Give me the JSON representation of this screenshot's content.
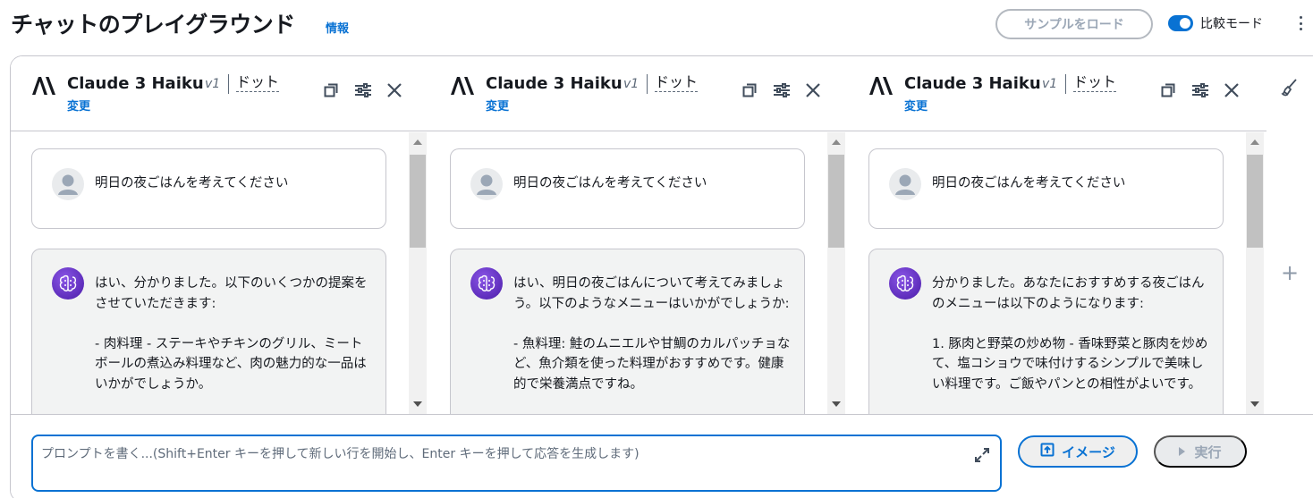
{
  "header": {
    "title": "チャットのプレイグラウンド",
    "info_label": "情報",
    "load_sample_label": "サンプルをロード",
    "compare_mode_label": "比較モード",
    "compare_mode_on": true
  },
  "panels": [
    {
      "model_name": "Claude 3 Haiku",
      "version": "v1",
      "variant": "ドット",
      "change_label": "変更",
      "user_message": "明日の夜ごはんを考えてください",
      "assistant_message": "はい、分かりました。以下のいくつかの提案をさせていただきます:\n\n- 肉料理 - ステーキやチキンのグリル、ミートボールの煮込み料理など、肉の魅力的な一品はいかがでしょうか。"
    },
    {
      "model_name": "Claude 3 Haiku",
      "version": "v1",
      "variant": "ドット",
      "change_label": "変更",
      "user_message": "明日の夜ごはんを考えてください",
      "assistant_message": "はい、明日の夜ごはんについて考えてみましょう。以下のようなメニューはいかがでしょうか:\n\n- 魚料理: 鮭のムニエルや甘鯛のカルパッチョなど、魚介類を使った料理がおすすめです。健康的で栄養満点ですね。"
    },
    {
      "model_name": "Claude 3 Haiku",
      "version": "v1",
      "variant": "ドット",
      "change_label": "変更",
      "user_message": "明日の夜ごはんを考えてください",
      "assistant_message": "分かりました。あなたにおすすめする夜ごはんのメニューは以下のようになります:\n\n1. 豚肉と野菜の炒め物 - 香味野菜と豚肉を炒めて、塩コショウで味付けするシンプルで美味しい料理です。ご飯やパンとの相性がよいです。"
    }
  ],
  "prompt": {
    "placeholder": "プロンプトを書く...(Shift+Enter キーを押して新しい行を開始し、Enter キーを押して応答を生成します)",
    "value": ""
  },
  "actions": {
    "image_label": "イメージ",
    "run_label": "実行"
  },
  "colors": {
    "accent": "#0972d3",
    "border": "#c6c6cd",
    "assistant_bubble": "#f2f3f3",
    "disabled_text": "#9ba7b6"
  },
  "icons": [
    "anthropic-logo-icon",
    "copy-icon",
    "settings-sliders-icon",
    "close-icon",
    "user-avatar-icon",
    "ai-brain-avatar-icon",
    "brush-icon",
    "plus-icon",
    "expand-icon",
    "upload-image-icon",
    "play-icon",
    "kebab-menu-icon"
  ]
}
